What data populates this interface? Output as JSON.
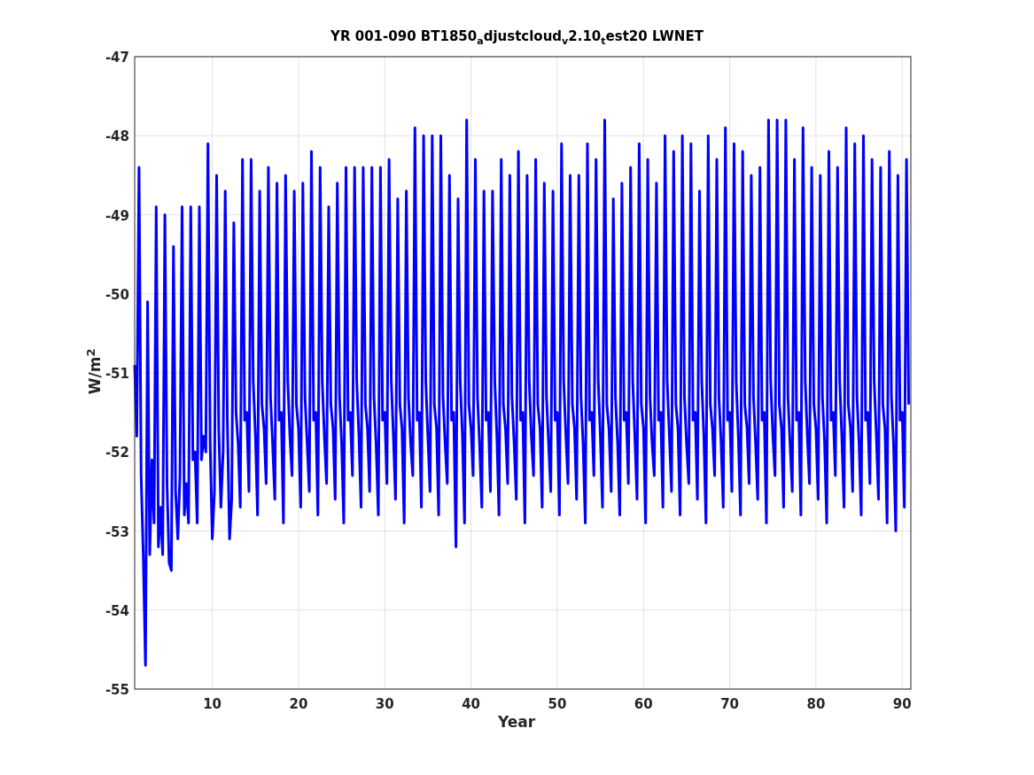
{
  "chart_data": {
    "type": "line",
    "title": "YR 001-090 BT1850$_{a}$djustcloud$_{v}$2.10$_{t}$est20 LWNET",
    "xlabel": "Year",
    "ylabel": "W/m$^{2}$",
    "xlim": [
      1,
      91
    ],
    "ylim": [
      -55,
      -47
    ],
    "grid": true,
    "xticks": [
      10,
      20,
      30,
      40,
      50,
      60,
      70,
      80,
      90
    ],
    "yticks": [
      -55,
      -54,
      -53,
      -52,
      -51,
      -50,
      -49,
      -48,
      -47
    ],
    "x": [
      1,
      1.25,
      1.5,
      1.75,
      2,
      2.25,
      2.5,
      2.75,
      3,
      3.25,
      3.5,
      3.75,
      4,
      4.25,
      4.5,
      4.75,
      5,
      5.25,
      5.5,
      5.75,
      6,
      6.25,
      6.5,
      6.75,
      7,
      7.25,
      7.5,
      7.75,
      8,
      8.25,
      8.5,
      8.75,
      9,
      9.25,
      9.5,
      9.75,
      10,
      10.25,
      10.5,
      10.75,
      11,
      11.25,
      11.5,
      11.75,
      12,
      12.25,
      12.5,
      12.75,
      13,
      13.25,
      13.5,
      13.75,
      14,
      14.25,
      14.5,
      14.75,
      15,
      15.25,
      15.5,
      15.75,
      16,
      16.25,
      16.5,
      16.75,
      17,
      17.25,
      17.5,
      17.75,
      18,
      18.25,
      18.5,
      18.75,
      19,
      19.25,
      19.5,
      19.75,
      20,
      20.25,
      20.5,
      20.75,
      21,
      21.25,
      21.5,
      21.75,
      22,
      22.25,
      22.5,
      22.75,
      23,
      23.25,
      23.5,
      23.75,
      24,
      24.25,
      24.5,
      24.75,
      25,
      25.25,
      25.5,
      25.75,
      26,
      26.25,
      26.5,
      26.75,
      27,
      27.25,
      27.5,
      27.75,
      28,
      28.25,
      28.5,
      28.75,
      29,
      29.25,
      29.5,
      29.75,
      30,
      30.25,
      30.5,
      30.75,
      31,
      31.25,
      31.5,
      31.75,
      32,
      32.25,
      32.5,
      32.75,
      33,
      33.25,
      33.5,
      33.75,
      34,
      34.25,
      34.5,
      34.75,
      35,
      35.25,
      35.5,
      35.75,
      36,
      36.25,
      36.5,
      36.75,
      37,
      37.25,
      37.5,
      37.75,
      38,
      38.25,
      38.5,
      38.75,
      39,
      39.25,
      39.5,
      39.75,
      40,
      40.25,
      40.5,
      40.75,
      41,
      41.25,
      41.5,
      41.75,
      42,
      42.25,
      42.5,
      42.75,
      43,
      43.25,
      43.5,
      43.75,
      44,
      44.25,
      44.5,
      44.75,
      45,
      45.25,
      45.5,
      45.75,
      46,
      46.25,
      46.5,
      46.75,
      47,
      47.25,
      47.5,
      47.75,
      48,
      48.25,
      48.5,
      48.75,
      49,
      49.25,
      49.5,
      49.75,
      50,
      50.25,
      50.5,
      50.75,
      51,
      51.25,
      51.5,
      51.75,
      52,
      52.25,
      52.5,
      52.75,
      53,
      53.25,
      53.5,
      53.75,
      54,
      54.25,
      54.5,
      54.75,
      55,
      55.25,
      55.5,
      55.75,
      56,
      56.25,
      56.5,
      56.75,
      57,
      57.25,
      57.5,
      57.75,
      58,
      58.25,
      58.5,
      58.75,
      59,
      59.25,
      59.5,
      59.75,
      60,
      60.25,
      60.5,
      60.75,
      61,
      61.25,
      61.5,
      61.75,
      62,
      62.25,
      62.5,
      62.75,
      63,
      63.25,
      63.5,
      63.75,
      64,
      64.25,
      64.5,
      64.75,
      65,
      65.25,
      65.5,
      65.75,
      66,
      66.25,
      66.5,
      66.75,
      67,
      67.25,
      67.5,
      67.75,
      68,
      68.25,
      68.5,
      68.75,
      69,
      69.25,
      69.5,
      69.75,
      70,
      70.25,
      70.5,
      70.75,
      71,
      71.25,
      71.5,
      71.75,
      72,
      72.25,
      72.5,
      72.75,
      73,
      73.25,
      73.5,
      73.75,
      74,
      74.25,
      74.5,
      74.75,
      75,
      75.25,
      75.5,
      75.75,
      76,
      76.25,
      76.5,
      76.75,
      77,
      77.25,
      77.5,
      77.75,
      78,
      78.25,
      78.5,
      78.75,
      79,
      79.25,
      79.5,
      79.75,
      80,
      80.25,
      80.5,
      80.75,
      81,
      81.25,
      81.5,
      81.75,
      82,
      82.25,
      82.5,
      82.75,
      83,
      83.25,
      83.5,
      83.75,
      84,
      84.25,
      84.5,
      84.75,
      85,
      85.25,
      85.5,
      85.75,
      86,
      86.25,
      86.5,
      86.75,
      87,
      87.25,
      87.5,
      87.75,
      88,
      88.25,
      88.5,
      88.75,
      89,
      89.25,
      89.5,
      89.75,
      90,
      90.25,
      90.5,
      90.75
    ],
    "series": [
      {
        "color": "#0000ff",
        "values": [
          -50.9,
          -51.8,
          -48.4,
          -52.3,
          -53.3,
          -54.7,
          -50.1,
          -53.3,
          -52.1,
          -52.9,
          -48.9,
          -53.2,
          -52.7,
          -53.3,
          -49.0,
          -52.4,
          -53.4,
          -53.5,
          -49.4,
          -52.5,
          -53.1,
          -52.3,
          -48.9,
          -52.8,
          -52.4,
          -52.9,
          -48.9,
          -52.1,
          -52.0,
          -52.9,
          -48.9,
          -52.1,
          -51.8,
          -52.0,
          -48.1,
          -51.9,
          -53.1,
          -52.5,
          -48.5,
          -51.7,
          -52.7,
          -52.0,
          -48.7,
          -51.6,
          -53.1,
          -52.6,
          -49.1,
          -51.5,
          -51.9,
          -52.7,
          -48.3,
          -51.6,
          -51.5,
          -52.5,
          -48.3,
          -51.1,
          -51.8,
          -52.8,
          -48.7,
          -51.4,
          -51.7,
          -52.4,
          -48.4,
          -51.3,
          -51.9,
          -52.6,
          -48.6,
          -51.6,
          -51.5,
          -52.9,
          -48.5,
          -51.1,
          -51.8,
          -52.3,
          -48.7,
          -51.4,
          -51.7,
          -52.7,
          -48.6,
          -51.3,
          -51.9,
          -52.5,
          -48.2,
          -51.6,
          -51.5,
          -52.8,
          -48.4,
          -51.1,
          -51.8,
          -52.4,
          -48.9,
          -51.4,
          -51.7,
          -52.6,
          -48.6,
          -51.3,
          -51.9,
          -52.9,
          -48.4,
          -51.6,
          -51.5,
          -52.3,
          -48.4,
          -51.1,
          -51.8,
          -52.7,
          -48.4,
          -51.4,
          -51.7,
          -52.5,
          -48.4,
          -51.3,
          -51.9,
          -52.8,
          -48.4,
          -51.6,
          -51.5,
          -52.4,
          -48.3,
          -51.1,
          -51.8,
          -52.6,
          -48.8,
          -51.4,
          -51.7,
          -52.9,
          -48.7,
          -51.3,
          -51.9,
          -52.3,
          -47.9,
          -51.6,
          -51.5,
          -52.7,
          -48.0,
          -51.1,
          -51.8,
          -52.5,
          -48.0,
          -51.4,
          -51.7,
          -52.8,
          -48.0,
          -51.3,
          -51.9,
          -52.4,
          -48.5,
          -51.6,
          -51.5,
          -53.2,
          -48.8,
          -51.1,
          -51.8,
          -52.9,
          -47.8,
          -51.4,
          -51.7,
          -52.3,
          -48.3,
          -51.3,
          -51.9,
          -52.7,
          -48.7,
          -51.6,
          -51.5,
          -52.5,
          -48.7,
          -51.1,
          -51.8,
          -52.8,
          -48.3,
          -51.4,
          -51.7,
          -52.4,
          -48.5,
          -51.3,
          -51.9,
          -52.6,
          -48.2,
          -51.6,
          -51.5,
          -52.9,
          -48.5,
          -51.1,
          -51.8,
          -52.3,
          -48.3,
          -51.4,
          -51.7,
          -52.7,
          -48.6,
          -51.3,
          -51.9,
          -52.5,
          -48.7,
          -51.6,
          -51.5,
          -52.8,
          -48.1,
          -51.1,
          -51.8,
          -52.4,
          -48.5,
          -51.4,
          -51.7,
          -52.6,
          -48.5,
          -51.3,
          -51.9,
          -52.9,
          -48.1,
          -51.6,
          -51.5,
          -52.3,
          -48.3,
          -51.1,
          -51.8,
          -52.7,
          -47.8,
          -51.4,
          -51.7,
          -52.5,
          -48.8,
          -51.3,
          -51.9,
          -52.8,
          -48.6,
          -51.6,
          -51.5,
          -52.4,
          -48.4,
          -51.1,
          -51.8,
          -52.6,
          -48.1,
          -51.4,
          -51.7,
          -52.9,
          -48.3,
          -51.3,
          -51.9,
          -52.3,
          -48.6,
          -51.6,
          -51.5,
          -52.7,
          -48.0,
          -51.1,
          -51.8,
          -52.5,
          -48.2,
          -51.4,
          -51.7,
          -52.8,
          -48.0,
          -51.3,
          -51.9,
          -52.4,
          -48.1,
          -51.6,
          -51.5,
          -52.6,
          -48.7,
          -51.1,
          -51.8,
          -52.9,
          -48.0,
          -51.4,
          -51.7,
          -52.3,
          -48.3,
          -51.3,
          -51.9,
          -52.7,
          -47.9,
          -51.6,
          -51.5,
          -52.5,
          -48.1,
          -51.1,
          -51.8,
          -52.8,
          -48.2,
          -51.4,
          -51.7,
          -52.4,
          -48.5,
          -51.3,
          -51.9,
          -52.6,
          -48.4,
          -51.6,
          -51.5,
          -52.9,
          -47.8,
          -51.1,
          -51.8,
          -52.3,
          -47.8,
          -51.4,
          -51.7,
          -52.7,
          -47.8,
          -51.3,
          -51.9,
          -52.5,
          -48.3,
          -51.6,
          -51.5,
          -52.8,
          -47.9,
          -51.1,
          -51.8,
          -52.4,
          -48.4,
          -51.4,
          -51.7,
          -52.6,
          -48.5,
          -51.3,
          -51.9,
          -52.9,
          -48.2,
          -51.6,
          -51.5,
          -52.3,
          -48.4,
          -51.1,
          -51.8,
          -52.7,
          -47.9,
          -51.4,
          -51.7,
          -52.5,
          -48.1,
          -51.3,
          -51.9,
          -52.8,
          -48.0,
          -51.6,
          -51.5,
          -52.4,
          -48.3,
          -51.1,
          -51.8,
          -52.6,
          -48.4,
          -51.4,
          -51.7,
          -52.9,
          -48.2,
          -51.3,
          -51.9,
          -53.0,
          -48.5,
          -51.6,
          -51.5,
          -52.7,
          -48.3,
          -51.4
        ]
      }
    ]
  }
}
